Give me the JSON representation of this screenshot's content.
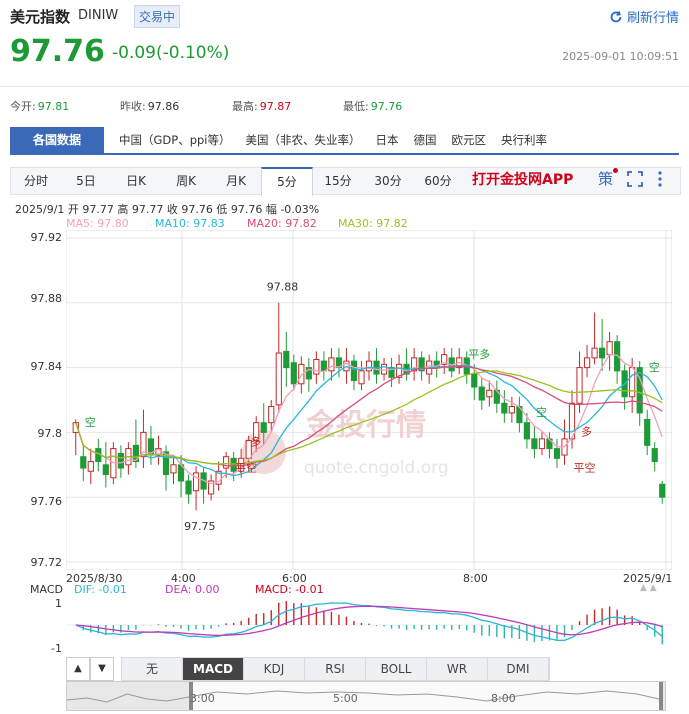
{
  "header": {
    "title": "美元指数",
    "code": "DINIW",
    "status": "交易中",
    "refresh_label": "刷新行情"
  },
  "quote": {
    "price": "97.76",
    "change": "-0.09(-0.10%)",
    "timestamp": "2025-09-01 10:09:51"
  },
  "stats": [
    {
      "label": "今开:",
      "value": "97.81",
      "color": "green"
    },
    {
      "label": "昨收:",
      "value": "97.86",
      "color": "gray"
    },
    {
      "label": "最高:",
      "value": "97.87",
      "color": "red"
    },
    {
      "label": "最低:",
      "value": "97.76",
      "color": "green"
    }
  ],
  "nav": {
    "active": "各国数据",
    "items": [
      "中国（GDP、ppi等）",
      "美国（非农、失业率）",
      "日本",
      "德国",
      "欧元区",
      "央行利率"
    ]
  },
  "tabs": [
    "分时",
    "5日",
    "日K",
    "周K",
    "月K",
    "5分",
    "15分",
    "30分",
    "60分"
  ],
  "active_tab": "5分",
  "app_banner": "打开金投网APP",
  "tool_icons": {
    "strategy": "策",
    "fullscreen": "fullscreen-icon",
    "more": "more-icon"
  },
  "info_line": "2025/9/1  开 97.77  高 97.77  收 97.76  低 97.76  幅 -0.03%",
  "ma_legend": [
    {
      "label": "MA5: 97.80",
      "color": "#f4a0bb"
    },
    {
      "label": "MA10: 97.83",
      "color": "#29b6d6"
    },
    {
      "label": "MA20: 97.82",
      "color": "#d94f7a"
    },
    {
      "label": "MA30: 97.82",
      "color": "#9ac21f"
    }
  ],
  "watermark": {
    "cn": "金投行情",
    "url": "quote.cngold.org"
  },
  "annotations": [
    {
      "text": "97.88",
      "type": "high"
    },
    {
      "text": "97.75",
      "type": "low"
    },
    {
      "text": "空"
    },
    {
      "text": "平空"
    },
    {
      "text": "多"
    },
    {
      "text": "平多"
    },
    {
      "text": "空"
    },
    {
      "text": "平空"
    },
    {
      "text": "多"
    },
    {
      "text": "空"
    }
  ],
  "macd": {
    "label": "MACD",
    "dif": "DIF: -0.01",
    "dea": "DEA: 0.00",
    "macd": "MACD: -0.01",
    "y_ticks": [
      "1",
      "-1"
    ]
  },
  "indicators": [
    "无",
    "MACD",
    "KDJ",
    "RSI",
    "BOLL",
    "WR",
    "DMI"
  ],
  "active_indicator": "MACD",
  "navigator_labels": [
    "3:00",
    "5:00",
    "8:00"
  ],
  "chart_data": {
    "type": "candlestick",
    "y_ticks": [
      "97.92",
      "97.88",
      "97.84",
      "97.8",
      "97.76",
      "97.72"
    ],
    "ylim": [
      97.72,
      97.92
    ],
    "x_ticks": [
      "2025/8/30",
      "4:00",
      "6:00",
      "8:00",
      "2025/9/1"
    ],
    "candles": [
      [
        97.8,
        97.806,
        97.786,
        97.808
      ],
      [
        97.785,
        97.778,
        97.77,
        97.792
      ],
      [
        97.776,
        97.782,
        97.768,
        97.79
      ],
      [
        97.79,
        97.782,
        97.776,
        97.796
      ],
      [
        97.78,
        97.774,
        97.766,
        97.794
      ],
      [
        97.772,
        97.79,
        97.768,
        97.794
      ],
      [
        97.787,
        97.778,
        97.772,
        97.792
      ],
      [
        97.78,
        97.79,
        97.774,
        97.794
      ],
      [
        97.792,
        97.782,
        97.778,
        97.808
      ],
      [
        97.785,
        97.8,
        97.778,
        97.814
      ],
      [
        97.796,
        97.786,
        97.78,
        97.804
      ],
      [
        97.786,
        97.79,
        97.78,
        97.798
      ],
      [
        97.788,
        97.774,
        97.764,
        97.792
      ],
      [
        97.775,
        97.78,
        97.768,
        97.784
      ],
      [
        97.78,
        97.77,
        97.76,
        97.786
      ],
      [
        97.77,
        97.762,
        97.756,
        97.774
      ],
      [
        97.764,
        97.775,
        97.752,
        97.779
      ],
      [
        97.775,
        97.765,
        97.756,
        97.778
      ],
      [
        97.762,
        97.77,
        97.758,
        97.774
      ],
      [
        97.768,
        97.776,
        97.764,
        97.782
      ],
      [
        97.778,
        97.785,
        97.772,
        97.788
      ],
      [
        97.784,
        97.776,
        97.77,
        97.788
      ],
      [
        97.776,
        97.784,
        97.772,
        97.79
      ],
      [
        97.784,
        97.795,
        97.776,
        97.798
      ],
      [
        97.795,
        97.806,
        97.788,
        97.81
      ],
      [
        97.806,
        97.8,
        97.792,
        97.818
      ],
      [
        97.806,
        97.816,
        97.8,
        97.82
      ],
      [
        97.817,
        97.849,
        97.812,
        97.88
      ],
      [
        97.85,
        97.84,
        97.828,
        97.862
      ],
      [
        97.843,
        97.83,
        97.826,
        97.848
      ],
      [
        97.83,
        97.842,
        97.824,
        97.847
      ],
      [
        97.84,
        97.833,
        97.825,
        97.846
      ],
      [
        97.836,
        97.845,
        97.83,
        97.85
      ],
      [
        97.844,
        97.838,
        97.832,
        97.85
      ],
      [
        97.838,
        97.846,
        97.832,
        97.852
      ],
      [
        97.846,
        97.84,
        97.834,
        97.852
      ],
      [
        97.838,
        97.844,
        97.83,
        97.852
      ],
      [
        97.844,
        97.832,
        97.826,
        97.848
      ],
      [
        97.83,
        97.838,
        97.826,
        97.844
      ],
      [
        97.838,
        97.844,
        97.832,
        97.85
      ],
      [
        97.844,
        97.836,
        97.83,
        97.852
      ],
      [
        97.836,
        97.842,
        97.832,
        97.846
      ],
      [
        97.84,
        97.834,
        97.828,
        97.846
      ],
      [
        97.834,
        97.842,
        97.83,
        97.848
      ],
      [
        97.842,
        97.836,
        97.832,
        97.852
      ],
      [
        97.838,
        97.846,
        97.832,
        97.852
      ],
      [
        97.846,
        97.838,
        97.832,
        97.85
      ],
      [
        97.836,
        97.844,
        97.83,
        97.848
      ],
      [
        97.844,
        97.84,
        97.834,
        97.85
      ],
      [
        97.842,
        97.848,
        97.836,
        97.852
      ],
      [
        97.846,
        97.838,
        97.834,
        97.852
      ],
      [
        97.84,
        97.846,
        97.836,
        97.852
      ],
      [
        97.846,
        97.836,
        97.83,
        97.85
      ],
      [
        97.836,
        97.828,
        97.82,
        97.842
      ],
      [
        97.828,
        97.82,
        97.814,
        97.834
      ],
      [
        97.822,
        97.826,
        97.816,
        97.832
      ],
      [
        97.826,
        97.818,
        97.812,
        97.832
      ],
      [
        97.818,
        97.812,
        97.806,
        97.826
      ],
      [
        97.812,
        97.816,
        97.806,
        97.822
      ],
      [
        97.816,
        97.806,
        97.8,
        97.822
      ],
      [
        97.806,
        97.796,
        97.79,
        97.812
      ],
      [
        97.796,
        97.79,
        97.784,
        97.804
      ],
      [
        97.79,
        97.796,
        97.786,
        97.8
      ],
      [
        97.796,
        97.79,
        97.784,
        97.8
      ],
      [
        97.79,
        97.784,
        97.778,
        97.796
      ],
      [
        97.786,
        97.796,
        97.78,
        97.808
      ],
      [
        97.796,
        97.818,
        97.79,
        97.826
      ],
      [
        97.818,
        97.84,
        97.812,
        97.85
      ],
      [
        97.84,
        97.846,
        97.834,
        97.854
      ],
      [
        97.846,
        97.852,
        97.842,
        97.874
      ],
      [
        97.852,
        97.846,
        97.838,
        97.87
      ],
      [
        97.848,
        97.856,
        97.838,
        97.862
      ],
      [
        97.856,
        97.838,
        97.83,
        97.86
      ],
      [
        97.838,
        97.822,
        97.814,
        97.842
      ],
      [
        97.822,
        97.84,
        97.812,
        97.846
      ],
      [
        97.84,
        97.812,
        97.804,
        97.844
      ],
      [
        97.808,
        97.792,
        97.786,
        97.814
      ],
      [
        97.79,
        97.782,
        97.776,
        97.794
      ],
      [
        97.768,
        97.76,
        97.756,
        97.77
      ]
    ]
  }
}
